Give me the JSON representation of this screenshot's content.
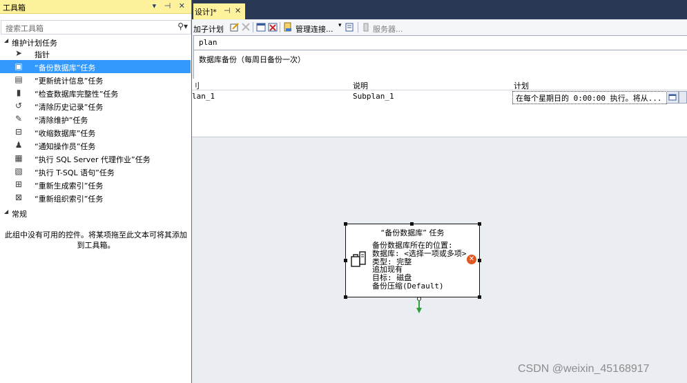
{
  "toolbox": {
    "title": "工具箱",
    "title_buttons": "▾ ⊣ ✕",
    "search_placeholder": "搜索工具箱",
    "search_icon": "search-icon",
    "group_maintenance": "维护计划任务",
    "items": [
      {
        "label": "指针",
        "icon": "pointer-icon"
      },
      {
        "label": "“备份数据库”任务",
        "icon": "backup-database-icon"
      },
      {
        "label": "“更新统计信息”任务",
        "icon": "update-statistics-icon"
      },
      {
        "label": "“检查数据库完整性”任务",
        "icon": "check-integrity-icon"
      },
      {
        "label": "“清除历史记录”任务",
        "icon": "history-cleanup-icon"
      },
      {
        "label": "“清除维护”任务",
        "icon": "maintenance-cleanup-icon"
      },
      {
        "label": "“收缩数据库”任务",
        "icon": "shrink-database-icon"
      },
      {
        "label": "“通知操作员”任务",
        "icon": "notify-operator-icon"
      },
      {
        "label": "“执行 SQL Server 代理作业”任务",
        "icon": "agent-job-icon"
      },
      {
        "label": "“执行 T-SQL 语句”任务",
        "icon": "tsql-icon"
      },
      {
        "label": "“重新生成索引”任务",
        "icon": "rebuild-index-icon"
      },
      {
        "label": "“重新组织索引”任务",
        "icon": "reorganize-index-icon"
      }
    ],
    "group_general": "常规",
    "empty_message": "此组中没有可用的控件。将某项拖至此文本可将其添加到工具箱。"
  },
  "document_tab": {
    "label": "设计]*",
    "pin": "⊣",
    "close": "✕"
  },
  "toolbar": {
    "add_subplan": "加子计划",
    "manage_connections": "管理连接...",
    "servers": "服务器..."
  },
  "plan": {
    "name": "plan",
    "description": "数据库备份（每周日备份一次）"
  },
  "subplans_grid": {
    "headers": [
      "刂",
      "说明",
      "计划"
    ],
    "rows": [
      {
        "name": "lan_1",
        "description": "Subplan_1",
        "schedule": "在每个星期日的 0:00:00 执行。将从..."
      }
    ]
  },
  "task_box": {
    "title": "“备份数据库” 任务",
    "lines": [
      "备份数据库所在的位置:",
      "数据库: <选择一项或多项>",
      "类型: 完整",
      "追加现有",
      "目标: 磁盘",
      "备份压缩(Default)"
    ],
    "error_icon": "error-icon"
  },
  "watermark": "CSDN @weixin_45168917",
  "colors": {
    "selection": "#3399ff",
    "active_title": "#fff29d",
    "tab_bar": "#293955",
    "canvas": "#eaedf2"
  }
}
